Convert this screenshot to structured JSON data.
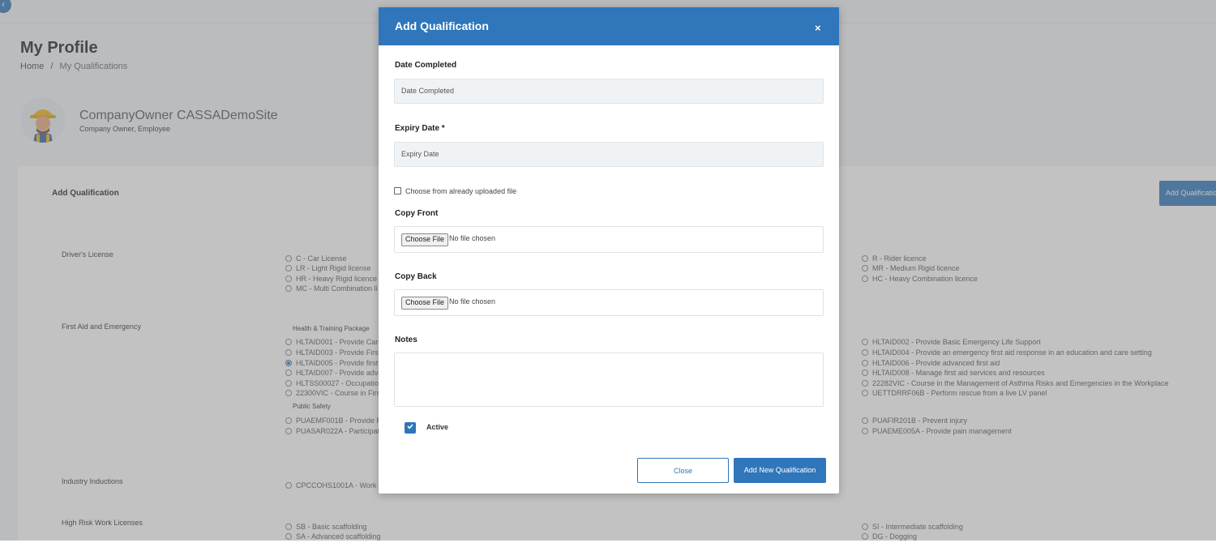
{
  "page": {
    "title": "My Profile",
    "breadcrumb": {
      "home": "Home",
      "separator": "/",
      "current": "My Qualifications"
    },
    "user": {
      "name": "CompanyOwner CASSADemoSite",
      "roles": "Company Owner, Employee"
    },
    "card_title": "Add Qualification",
    "add_button": "Add Qualification",
    "sections": {
      "drivers": {
        "label": "Driver's License",
        "left": [
          "C - Car License",
          "LR - Light Rigid license",
          "HR - Heavy Rigid licence",
          "MC - Multi Combination li"
        ],
        "right": [
          "R - Rider licence",
          "MR - Medium Rigid licence",
          "HC - Heavy Combination licence"
        ]
      },
      "first_aid": {
        "label": "First Aid and Emergency",
        "group1": "Health & Training Package",
        "left": [
          "HLTAID001 - Provide Card",
          "HLTAID003 - Provide First",
          "HLTAID005 - Provide first",
          "HLTAID007 - Provide adva",
          "HLTSS00027 - Occupation",
          "22300VIC - Course in First"
        ],
        "right": [
          "HLTAID002 - Provide Basic Emergency Life Support",
          "HLTAID004 - Provide an emergency first aid response in an education and care setting",
          "HLTAID006 - Provide advanced first aid",
          "HLTAID008 - Manage first aid services and resources",
          "22282VIC - Course in the Management of Asthma Risks and Emergencies in the Workplace",
          "UETTDRRF06B - Perform rescue from a live LV panel"
        ],
        "group2": "Public Safety",
        "left2": [
          "PUAEMF001B - Provide Fi",
          "PUASAR022A - Participate"
        ],
        "right2": [
          "PUAFIR201B - Prevent injury",
          "PUAEME005A - Provide pain management"
        ]
      },
      "inductions": {
        "label": "Industry Inductions",
        "left": [
          "CPCCOHS1001A - Work Sa"
        ]
      },
      "high_risk": {
        "label": "High Risk Work Licenses",
        "left": [
          "SB - Basic scaffolding",
          "SA - Advanced scaffolding"
        ],
        "right": [
          "SI - Intermediate scaffolding",
          "DG - Dogging"
        ]
      }
    }
  },
  "modal": {
    "title": "Add Qualification",
    "close_icon": "×",
    "date_completed": {
      "label": "Date Completed",
      "placeholder": "Date Completed"
    },
    "expiry_date": {
      "label": "Expiry Date *",
      "placeholder": "Expiry Date"
    },
    "choose_uploaded": "Choose from already uploaded file",
    "copy_front": {
      "label": "Copy Front",
      "button": "Choose File",
      "status": "No file chosen"
    },
    "copy_back": {
      "label": "Copy Back",
      "button": "Choose File",
      "status": "No file chosen"
    },
    "notes_label": "Notes",
    "active_label": "Active",
    "active_checked": true,
    "close_button": "Close",
    "submit_button": "Add New Qualification"
  },
  "colors": {
    "primary": "#2f76ba",
    "overlay": "rgba(120,120,120,0.45)"
  }
}
